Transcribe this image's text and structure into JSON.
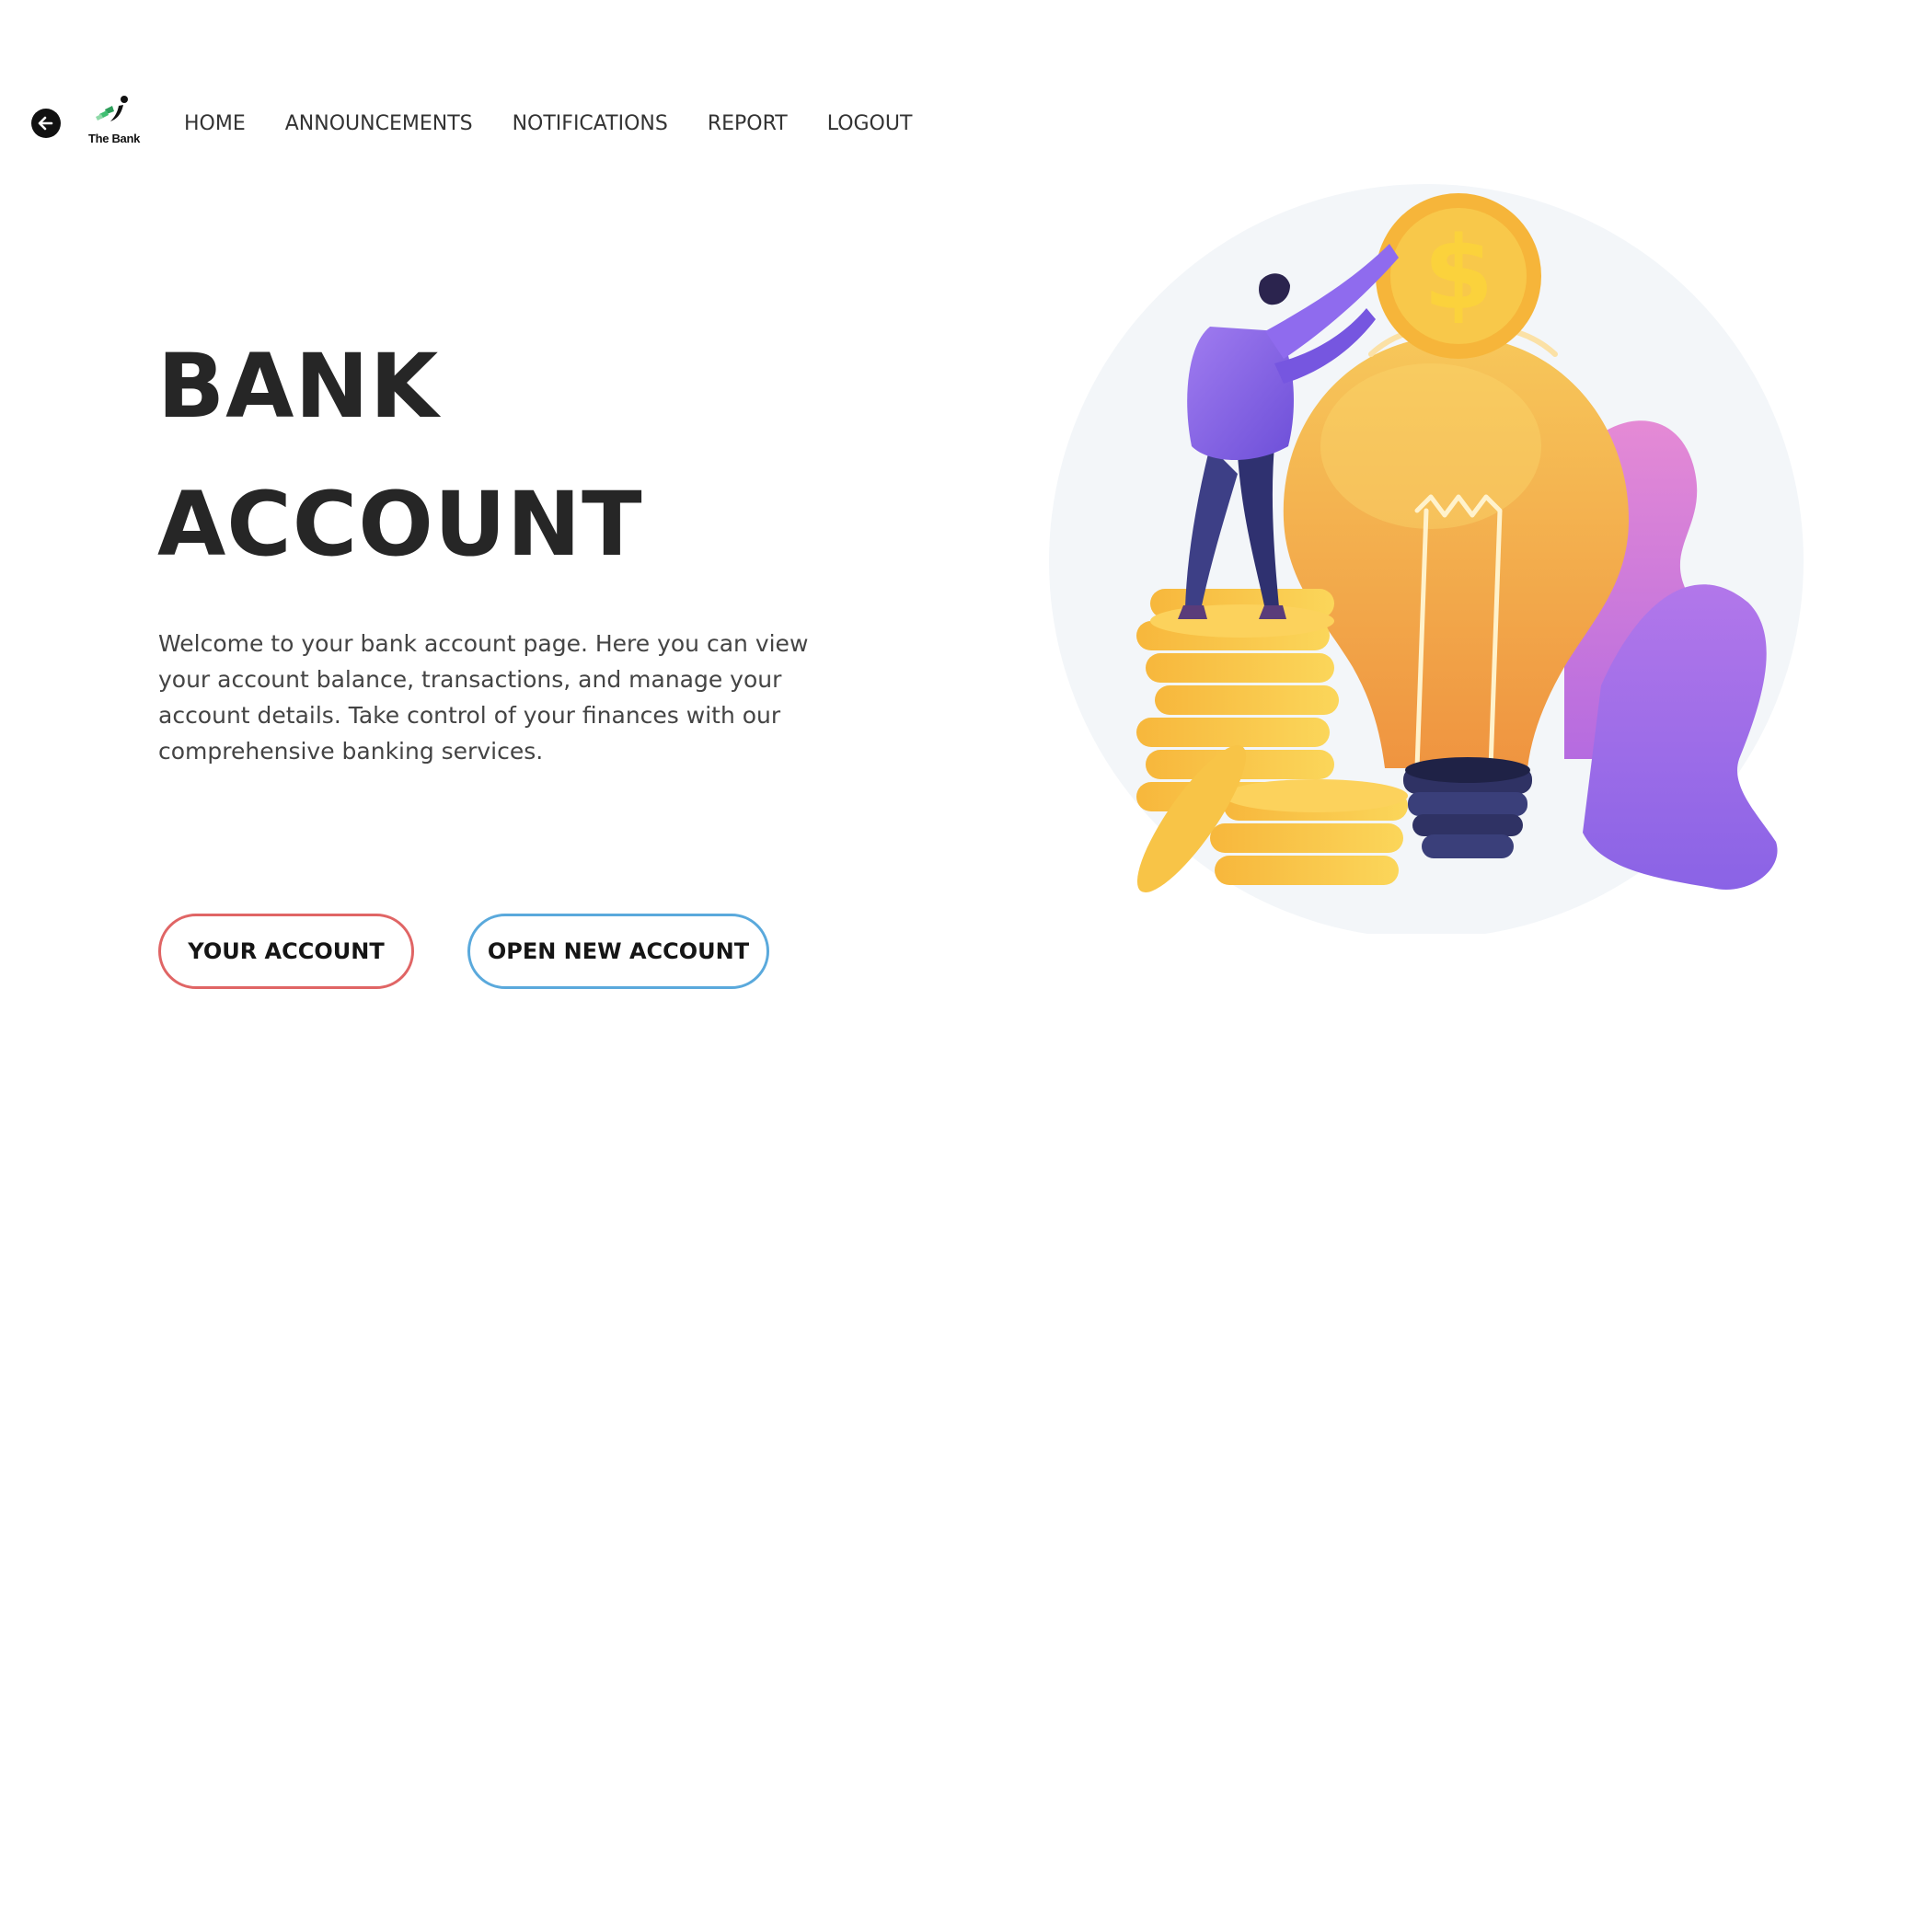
{
  "header": {
    "back_icon": "arrow-left-circle-icon",
    "logo": {
      "text": "The Bank",
      "icon": "bank-logo-icon"
    },
    "nav": [
      {
        "label": "HOME"
      },
      {
        "label": "ANNOUNCEMENTS"
      },
      {
        "label": "NOTIFICATIONS"
      },
      {
        "label": "REPORT"
      },
      {
        "label": "LOGOUT"
      }
    ]
  },
  "hero": {
    "title_line1": "BANK",
    "title_line2": "ACCOUNT",
    "description": "Welcome to your bank account page. Here you can view your account balance, transactions, and manage your account details. Take control of your finances with our comprehensive banking services."
  },
  "buttons": {
    "your_account": "YOUR ACCOUNT",
    "open_new_account": "OPEN NEW ACCOUNT"
  },
  "illustration": {
    "description_icon": "lightbulb-coins-illustration",
    "coin_symbol": "$"
  },
  "colors": {
    "text_dark": "#262626",
    "your_account_border": "#e06565",
    "open_account_border": "#5aa9dc",
    "coin_gold": "#f6b53a",
    "bulb_orange": "#f0a346",
    "purple": "#8a63e6",
    "pink": "#e089d8",
    "navy": "#2f3264"
  }
}
